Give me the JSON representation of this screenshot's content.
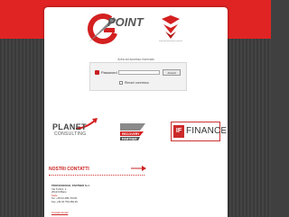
{
  "header": {
    "logo_letter": "G",
    "logo_word": "POINT",
    "logo_trademark": "®",
    "right_logo_caption": "professional partners\npuntoG"
  },
  "login": {
    "title": "Area ad accesso riservato",
    "password_label": "Password",
    "password_value": "",
    "submit_label": "Accedi",
    "remember_label": "Rimani connesso"
  },
  "partners": {
    "planet_title": "PLANET",
    "planet_sub": "CONSULTING",
    "recovery_line1": "RECOVERY",
    "recovery_line2": "PARTNER",
    "finance_mark": "IF",
    "finance_label": "FINANCE"
  },
  "contacts": {
    "title": "NOSTRI CONTATTI",
    "company_name": "PROFESSIONAL PARTNER S.r.l.",
    "address_line1": "Via Turbini, 2",
    "address_line2": "20123 Milano",
    "hq_label": "Sede",
    "phone": "Tel. +39 02.489.733.81",
    "fax": "Fax +39 02.759.484.49",
    "email_link": "Contatto Email"
  },
  "colors": {
    "brand_red": "#e02424",
    "background_dark": "#404040"
  }
}
